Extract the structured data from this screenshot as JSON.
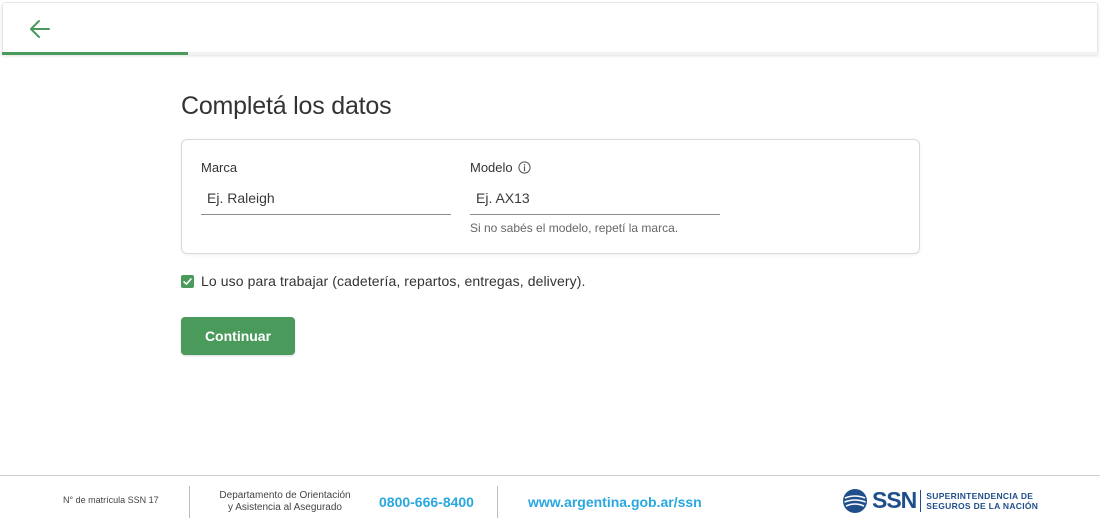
{
  "header": {
    "back_icon": "arrow-left-icon",
    "progress_fraction": 0.17,
    "accent_color": "#4a9a5c"
  },
  "main": {
    "title": "Completá los datos",
    "marca": {
      "label": "Marca",
      "placeholder": "Ej. Raleigh",
      "value": ""
    },
    "modelo": {
      "label": "Modelo",
      "info_icon": "info-icon",
      "placeholder": "Ej. AX13",
      "value": "",
      "helper": "Si no sabés el modelo, repetí la marca."
    },
    "checkbox": {
      "checked": true,
      "label": "Lo uso para trabajar (cadetería, repartos, entregas, delivery)."
    },
    "continue_label": "Continuar"
  },
  "footer": {
    "matricula": "N° de matrícula SSN 17",
    "depto_line1": "Departamento de Orientación",
    "depto_line2": "y Asistencia al Asegurado",
    "phone": "0800-666-8400",
    "website": "www.argentina.gob.ar/ssn",
    "logo_text": "SSN",
    "logo_sub1": "SUPERINTENDENCIA DE",
    "logo_sub2": "SEGUROS DE LA NACIÓN",
    "link_color": "#29a7df",
    "brand_color": "#1f4f8b"
  }
}
